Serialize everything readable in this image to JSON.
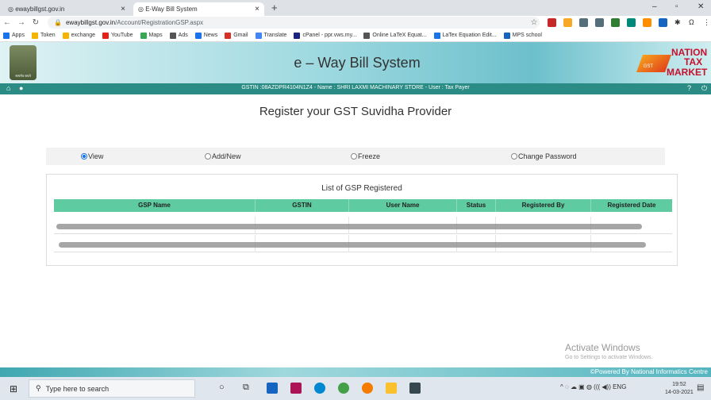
{
  "browser": {
    "tabs": [
      {
        "title": "ewaybillgst.gov.in"
      },
      {
        "title": "E-Way Bill System"
      }
    ],
    "url_host": "ewaybillgst.gov.in",
    "url_path": "/Account/RegistrationGSP.aspx",
    "bookmarks": [
      "Apps",
      "Token",
      "exchange",
      "YouTube",
      "Maps",
      "Ads",
      "News",
      "Gmail",
      "Translate",
      "cPanel - ppr.vws.my...",
      "Online LaTeX Equat...",
      "LaTex Equation Edit...",
      "MPS school"
    ],
    "bookmark_colors": [
      "#1a73e8",
      "#f4b400",
      "#f4b400",
      "#e62117",
      "#34a853",
      "#555555",
      "#1a73e8",
      "#d93025",
      "#4285f4",
      "#1a237e",
      "#555555",
      "#1a73e8",
      "#1565c0"
    ]
  },
  "header": {
    "emblem_caption": "सत्यमेव जयते",
    "title": "e – Way Bill System",
    "ntm_line1": "NATION",
    "ntm_line2": "TAX",
    "ntm_line3": "MARKET",
    "ntm_badge": "GST"
  },
  "userbar": {
    "info": "GSTIN :08AZDPR4104N1Z4 - Name : SHRI LAXMI MACHINARY STORE - User : Tax Payer"
  },
  "page": {
    "title": "Register your GST Suvidha Provider",
    "options": [
      {
        "label": "View",
        "selected": true
      },
      {
        "label": "Add/New",
        "selected": false
      },
      {
        "label": "Freeze",
        "selected": false
      },
      {
        "label": "Change Password",
        "selected": false
      }
    ]
  },
  "table": {
    "caption": "List of GSP Registered",
    "columns": [
      "GSP Name",
      "GSTIN",
      "User Name",
      "Status",
      "Registered By",
      "Registered Date"
    ]
  },
  "watermark": {
    "line1": "Activate Windows",
    "line2": "Go to Settings to activate Windows."
  },
  "footer": {
    "text": "©Powered By National Informatics Centre"
  },
  "taskbar": {
    "search_placeholder": "Type here to search",
    "tray": "ENG",
    "time": "19:52",
    "date": "14-03-2021"
  },
  "colors": {
    "header_bar": "#2a8c84",
    "table_header": "#5ecba0",
    "accent": "#1a73e8"
  }
}
